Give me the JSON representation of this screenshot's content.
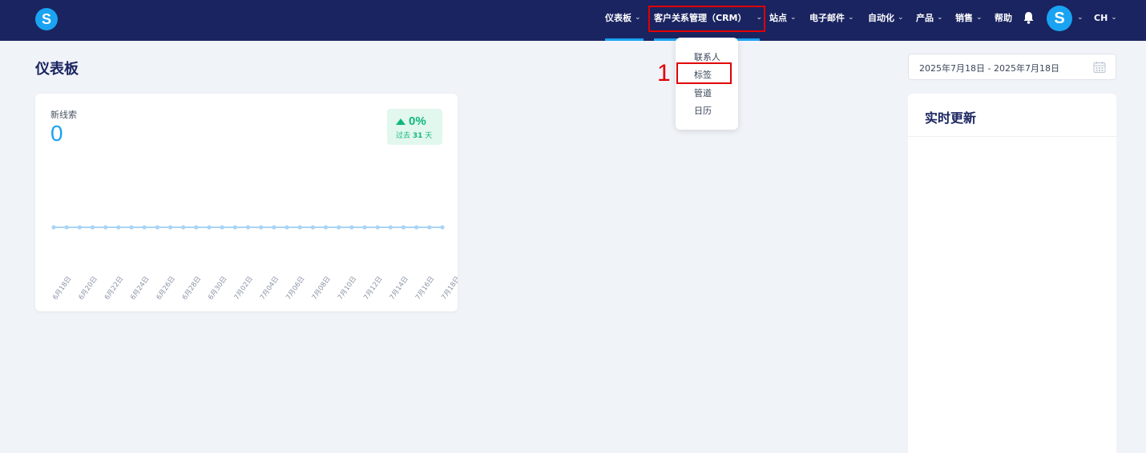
{
  "topbar": {
    "logo_letter": "S",
    "nav": [
      {
        "label": "仪表板"
      },
      {
        "label": "客户关系管理（CRM）"
      },
      {
        "label": "站点"
      },
      {
        "label": "电子邮件"
      },
      {
        "label": "自动化"
      },
      {
        "label": "产品"
      },
      {
        "label": "销售"
      },
      {
        "label": "帮助"
      }
    ],
    "avatar_letter": "S",
    "language": "CH",
    "chevron": "⌄"
  },
  "crm_dropdown": {
    "items": [
      {
        "label": "联系人"
      },
      {
        "label": "标签"
      },
      {
        "label": "管道"
      },
      {
        "label": "日历"
      }
    ]
  },
  "annotation": {
    "marker": "1"
  },
  "page": {
    "title": "仪表板"
  },
  "leads_card": {
    "label": "新线索",
    "value": "0",
    "change": "0%",
    "period_prefix": "过去",
    "period_days": "31",
    "period_suffix": "天"
  },
  "chart_data": {
    "type": "line",
    "categories": [
      "6月18日",
      "6月20日",
      "6月22日",
      "6月24日",
      "6月26日",
      "6月28日",
      "6月30日",
      "7月02日",
      "7月04日",
      "7月06日",
      "7月08日",
      "7月10日",
      "7月12日",
      "7月14日",
      "7月16日",
      "7月18日"
    ],
    "x": [
      "6月18日",
      "6月19日",
      "6月20日",
      "6月21日",
      "6月22日",
      "6月23日",
      "6月24日",
      "6月25日",
      "6月26日",
      "6月27日",
      "6月28日",
      "6月29日",
      "6月30日",
      "7月01日",
      "7月02日",
      "7月03日",
      "7月04日",
      "7月05日",
      "7月06日",
      "7月07日",
      "7月08日",
      "7月09日",
      "7月10日",
      "7月11日",
      "7月12日",
      "7月13日",
      "7月14日",
      "7月15日",
      "7月16日",
      "7月17日",
      "7月18日"
    ],
    "series": [
      {
        "values": [
          0,
          0,
          0,
          0,
          0,
          0,
          0,
          0,
          0,
          0,
          0,
          0,
          0,
          0,
          0,
          0,
          0,
          0,
          0,
          0,
          0,
          0,
          0,
          0,
          0,
          0,
          0,
          0,
          0,
          0,
          0
        ]
      }
    ],
    "color": "#a9d4f5",
    "grid": false
  },
  "date_range": {
    "text": "2025年7月18日 - 2025年7月18日"
  },
  "live_updates": {
    "title": "实时更新"
  },
  "colors": {
    "nav_bg": "#1a2460",
    "accent": "#1aa3f2",
    "success": "#0fb87a",
    "highlight": "#e00000"
  }
}
